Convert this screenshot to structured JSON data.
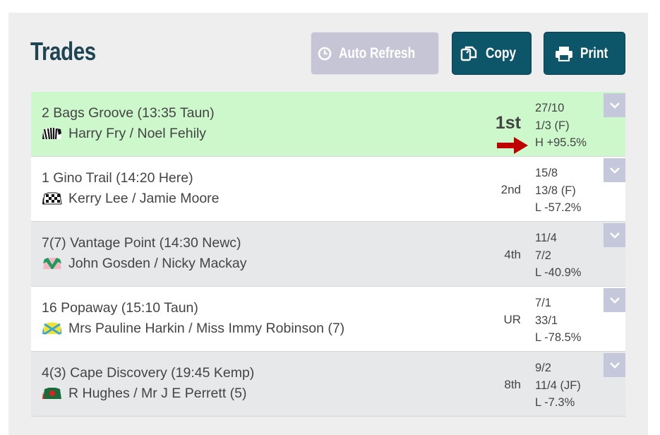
{
  "header": {
    "title": "Trades",
    "auto_refresh_label": "Auto Refresh",
    "copy_label": "Copy",
    "print_label": "Print"
  },
  "trades": [
    {
      "race": "2 Bags Groove (13:35 Taun)",
      "people": "Harry Fry / Noel Fehily",
      "position": "1st",
      "odds_1": "27/10",
      "odds_2": "1/3 (F)",
      "result": "H +95.5%",
      "highlight": true
    },
    {
      "race": "1 Gino Trail (14:20 Here)",
      "people": "Kerry Lee / Jamie Moore",
      "position": "2nd",
      "odds_1": "15/8",
      "odds_2": "13/8 (F)",
      "result": "L -57.2%"
    },
    {
      "race": "7(7) Vantage Point (14:30 Newc)",
      "people": "John Gosden / Nicky Mackay",
      "position": "4th",
      "odds_1": "11/4",
      "odds_2": "7/2",
      "result": "L -40.9%"
    },
    {
      "race": "16 Popaway (15:10 Taun)",
      "people": "Mrs Pauline Harkin / Miss Immy Robinson (7)",
      "position": "UR",
      "odds_1": "7/1",
      "odds_2": "33/1",
      "result": "L -78.5%"
    },
    {
      "race": "4(3) Cape Discovery (19:45 Kemp)",
      "people": "R Hughes / Mr J E Perrett (5)",
      "position": "8th",
      "odds_1": "9/2",
      "odds_2": "11/4 (JF)",
      "result": "L -7.3%"
    }
  ],
  "colors": {
    "brand": "#0d5568",
    "highlight_row": "#ccf8cc",
    "alt_row": "#e6e8ea",
    "disabled_button": "#c5c5d6",
    "arrow": "#c00000"
  }
}
